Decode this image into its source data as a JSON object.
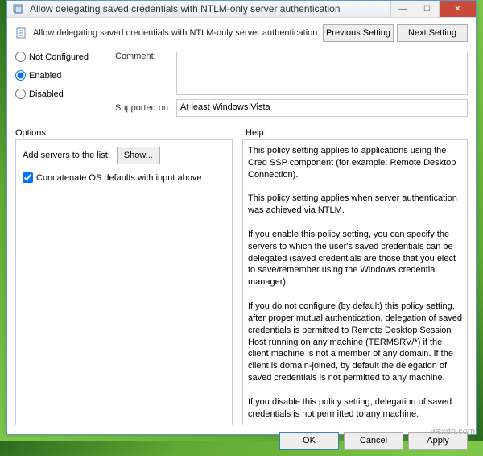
{
  "window": {
    "title": "Allow delegating saved credentials with NTLM-only server authentication"
  },
  "header": {
    "description": "Allow delegating saved credentials with NTLM-only server authentication",
    "prev_btn": "Previous Setting",
    "next_btn": "Next Setting"
  },
  "state": {
    "not_configured": "Not Configured",
    "enabled": "Enabled",
    "disabled": "Disabled",
    "selected": "enabled"
  },
  "form": {
    "comment_label": "Comment:",
    "comment_value": "",
    "supported_label": "Supported on:",
    "supported_value": "At least Windows Vista"
  },
  "labels": {
    "options": "Options:",
    "help": "Help:"
  },
  "options": {
    "add_servers_label": "Add servers to the list:",
    "show_btn": "Show...",
    "concat_label": "Concatenate OS defaults with input above",
    "concat_checked": true
  },
  "help_text": "This policy setting applies to applications using the Cred SSP component (for example: Remote Desktop Connection).\n\nThis policy setting applies when server authentication was achieved via NTLM.\n\nIf you enable this policy setting, you can specify the servers to which the user's saved credentials can be delegated (saved credentials are those that you elect to save/remember using the Windows credential manager).\n\nIf you do not configure (by default) this policy setting, after proper mutual authentication, delegation of saved credentials is permitted to Remote Desktop Session Host running on any machine (TERMSRV/*) if the client machine is not a member of any domain. If the client is domain-joined, by default the delegation of saved credentials is not permitted to any machine.\n\nIf you disable this policy setting, delegation of saved credentials is not permitted to any machine.",
  "footer": {
    "ok": "OK",
    "cancel": "Cancel",
    "apply": "Apply"
  }
}
